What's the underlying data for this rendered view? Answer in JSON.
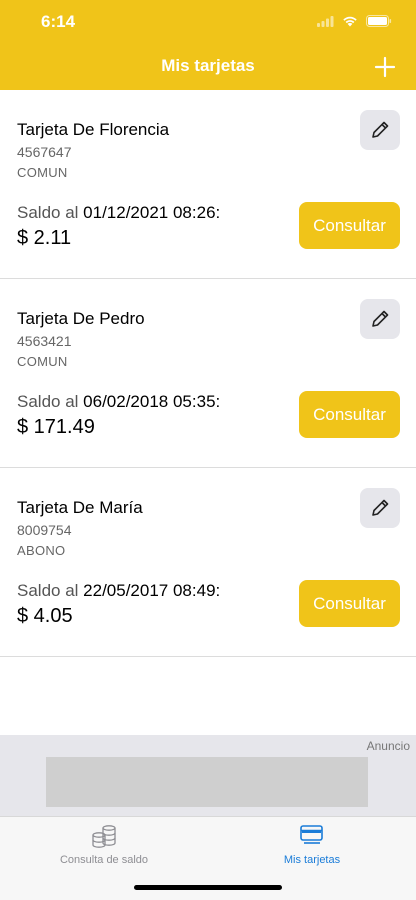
{
  "status_bar": {
    "time": "6:14"
  },
  "nav": {
    "title": "Mis tarjetas"
  },
  "cards": [
    {
      "name": "Tarjeta De Florencia",
      "number": "4567647",
      "type": "COMUN",
      "saldo_prefix": "Saldo al",
      "date": "01/12/2021 08:26:",
      "amount": "$ 2.11",
      "consult_label": "Consultar"
    },
    {
      "name": "Tarjeta De Pedro",
      "number": "4563421",
      "type": "COMUN",
      "saldo_prefix": "Saldo al",
      "date": "06/02/2018 05:35:",
      "amount": "$ 171.49",
      "consult_label": "Consultar"
    },
    {
      "name": "Tarjeta De María",
      "number": "8009754",
      "type": "ABONO",
      "saldo_prefix": "Saldo al",
      "date": "22/05/2017 08:49:",
      "amount": "$ 4.05",
      "consult_label": "Consultar"
    }
  ],
  "ad": {
    "label": "Anuncio"
  },
  "tabs": [
    {
      "label": "Consulta de saldo",
      "icon": "coins-icon",
      "active": false
    },
    {
      "label": "Mis tarjetas",
      "icon": "card-icon",
      "active": true
    }
  ],
  "colors": {
    "accent": "#F0C419",
    "tab_active": "#1A7CD8",
    "tab_inactive": "#8E8E93"
  }
}
